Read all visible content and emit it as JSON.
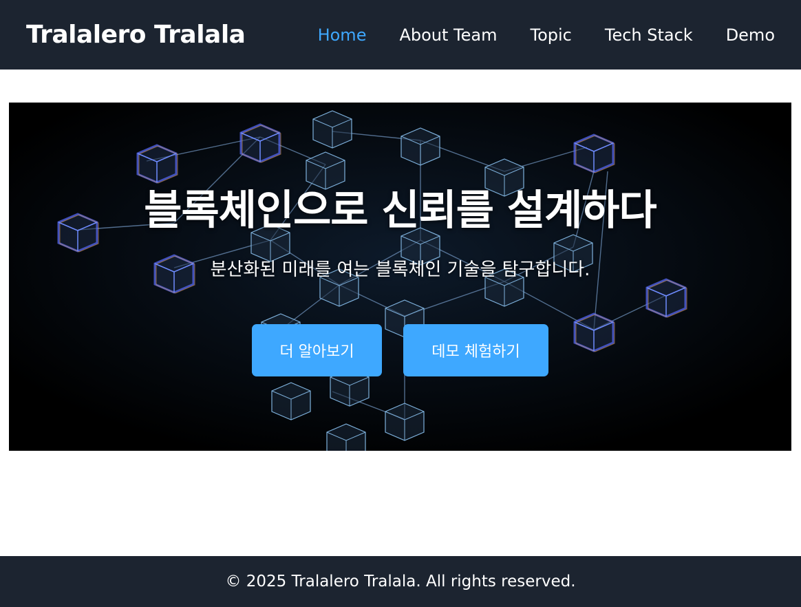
{
  "header": {
    "brand": "Tralalero Tralala",
    "nav": [
      {
        "label": "Home",
        "active": true
      },
      {
        "label": "About Team",
        "active": false
      },
      {
        "label": "Topic",
        "active": false
      },
      {
        "label": "Tech Stack",
        "active": false
      },
      {
        "label": "Demo",
        "active": false
      }
    ]
  },
  "hero": {
    "title": "블록체인으로 신뢰를 설계하다",
    "subtitle": "분산화된 미래를 여는 블록체인 기술을 탐구합니다.",
    "buttons": {
      "learn_more": "더 알아보기",
      "try_demo": "데모 체험하기"
    },
    "background": "blockchain-cubes-image"
  },
  "footer": {
    "copyright": "© 2025 Tralalero Tralala. All rights reserved."
  },
  "colors": {
    "nav_background": "#1c2430",
    "accent": "#3ea8ff",
    "hero_background": "#000000",
    "text_light": "#ffffff"
  }
}
